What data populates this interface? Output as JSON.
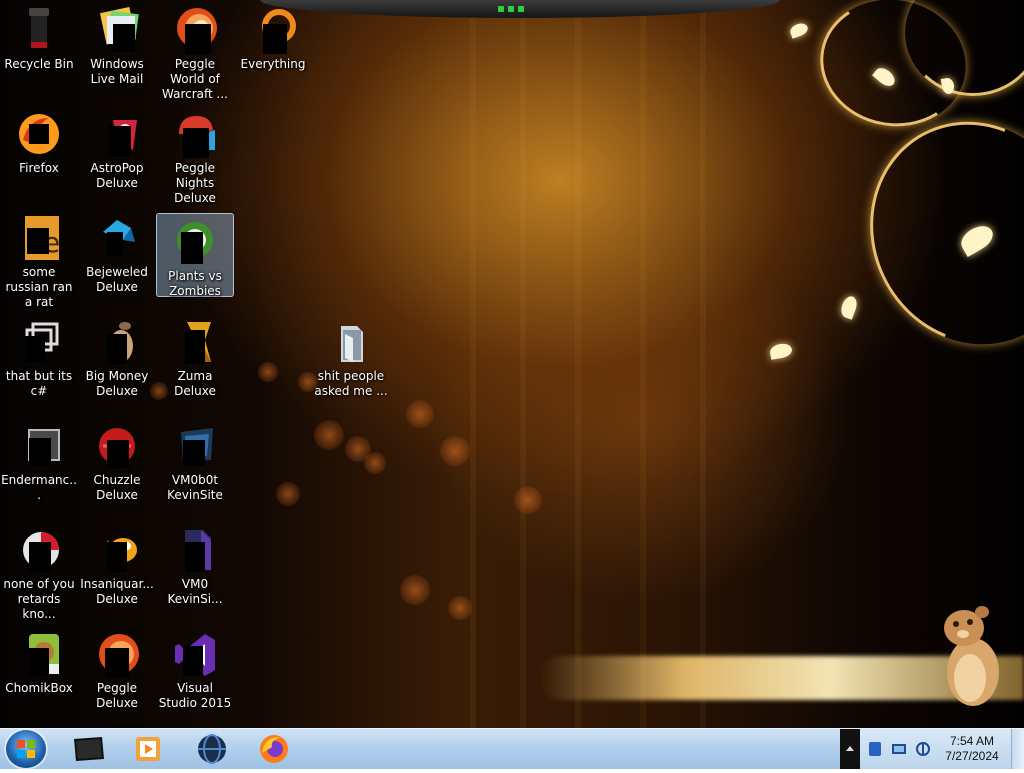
{
  "desktop": {
    "icons": [
      {
        "label": "Recycle Bin",
        "icon": "recycle-bin-icon"
      },
      {
        "label": "Windows Live Mail",
        "icon": "mail-icon"
      },
      {
        "label": "Peggle World of Warcraft ...",
        "icon": "peggle-icon"
      },
      {
        "label": "Everything",
        "icon": "search-icon"
      },
      {
        "label": "Firefox",
        "icon": "firefox-icon"
      },
      {
        "label": "AstroPop Deluxe",
        "icon": "game-icon"
      },
      {
        "label": "Peggle Nights Deluxe",
        "icon": "peggle-icon"
      },
      {
        "label": "some russian ran a rat",
        "icon": "app-icon"
      },
      {
        "label": "Bejeweled Deluxe",
        "icon": "gem-icon"
      },
      {
        "label": "Plants vs Zombies",
        "icon": "game-icon"
      },
      {
        "label": "that but its c#",
        "icon": "app-icon"
      },
      {
        "label": "Big Money Deluxe",
        "icon": "game-icon"
      },
      {
        "label": "Zuma Deluxe",
        "icon": "game-icon"
      },
      {
        "label": "shit people asked me ...",
        "icon": "folder-icon"
      },
      {
        "label": "Endermanc...",
        "icon": "app-icon"
      },
      {
        "label": "Chuzzle Deluxe",
        "icon": "game-icon"
      },
      {
        "label": "VM0b0t KevinSite",
        "icon": "folder-icon"
      },
      {
        "label": "none of you retards kno...",
        "icon": "app-icon"
      },
      {
        "label": "Insaniquar... Deluxe",
        "icon": "fish-icon"
      },
      {
        "label": "VM0 KevinSi...",
        "icon": "file-icon"
      },
      {
        "label": "ChomikBox",
        "icon": "hamster-icon"
      },
      {
        "label": "Peggle Deluxe",
        "icon": "peggle-icon"
      },
      {
        "label": "Visual Studio 2015",
        "icon": "visual-studio-icon"
      }
    ]
  },
  "taskbar": {
    "pinned": [
      {
        "name": "terminal",
        "icon": "terminal-icon"
      },
      {
        "name": "media-player",
        "icon": "media-player-icon"
      },
      {
        "name": "globe",
        "icon": "globe-icon"
      },
      {
        "name": "firefox",
        "icon": "firefox-icon"
      }
    ],
    "clock": {
      "time": "7:54 AM",
      "date": "7/27/2024"
    }
  },
  "colors": {
    "taskbar": "#b3d0ec",
    "selection": "#a0bedc",
    "accent_gold": "#ffd278"
  }
}
